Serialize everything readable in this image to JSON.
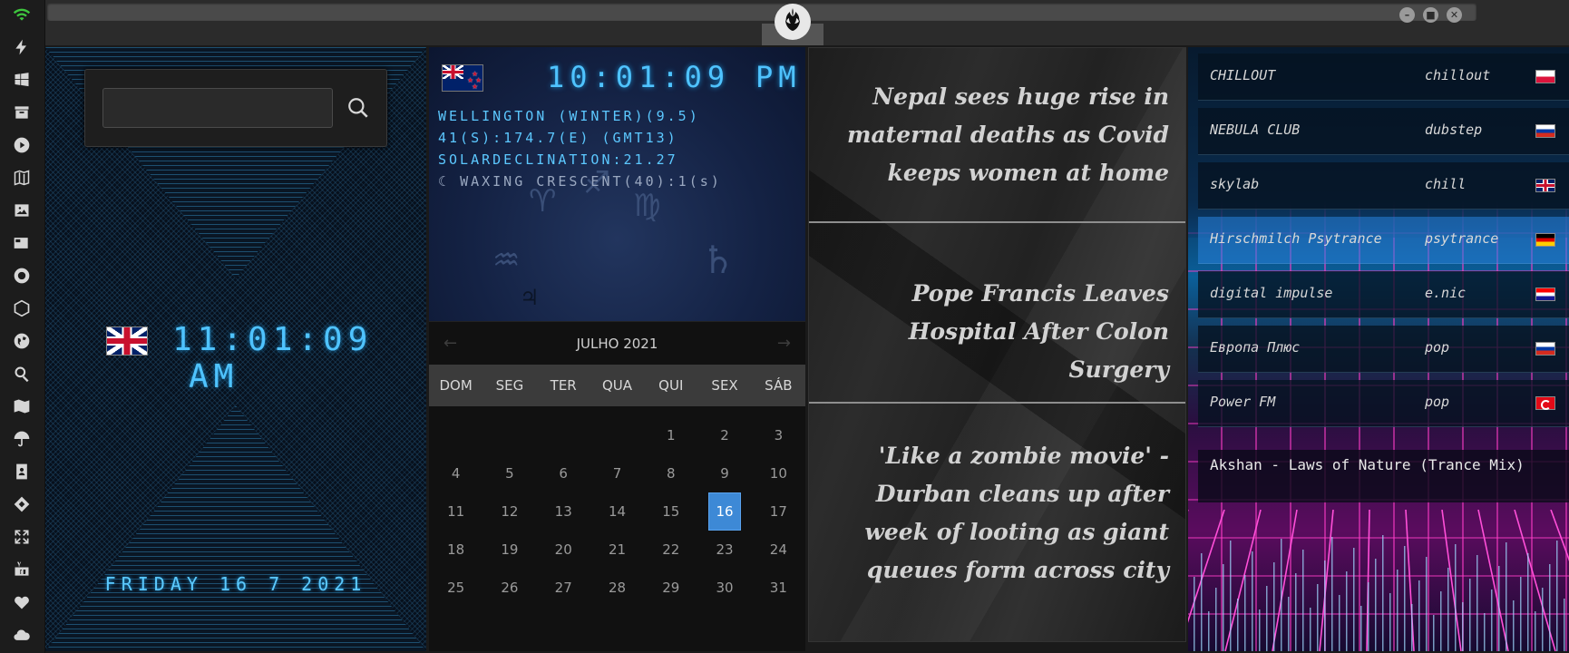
{
  "sidebar": {
    "icons": [
      "wifi-icon",
      "bolt-icon",
      "windows-icon",
      "archive-icon",
      "play-icon",
      "map-book-icon",
      "image-icon",
      "news-icon",
      "empire-icon",
      "rebel-hex-icon",
      "globe-icon",
      "search-icon",
      "map-icon",
      "umbrella-icon",
      "contacts-icon",
      "link-icon",
      "expand-icon",
      "youtube-icon",
      "heart-icon",
      "cloud-icon"
    ]
  },
  "window": {
    "minimize": "–",
    "maximize": "■",
    "close": "✕"
  },
  "search": {
    "value": "",
    "placeholder": ""
  },
  "local_clock": {
    "time": "11:01:09",
    "ampm": "AM",
    "date": "FRIDAY 16 7 2021"
  },
  "world_clock": {
    "time": "10:01:09",
    "ampm": "PM",
    "line1": "WELLINGTON (WINTER)(9.5)",
    "line2": "41(S):174.7(E) (GMT13)",
    "line3": "SOLARDECLINATION:21.27",
    "moon": "WAXING CRESCENT(40):1(s)"
  },
  "calendar": {
    "prev": "←",
    "next": "→",
    "title": "JULHO 2021",
    "weekdays": [
      "DOM",
      "SEG",
      "TER",
      "QUA",
      "QUI",
      "SEX",
      "SÁB"
    ],
    "leading_blanks": 4,
    "days": 31,
    "selected": 16
  },
  "news": [
    {
      "title": "Nepal sees huge rise in maternal deaths as Covid keeps women at home"
    },
    {
      "title": "Pope Francis Leaves Hospital After Colon Surgery"
    },
    {
      "title": "'Like a zombie movie' - Durban cleans up after week of looting as giant queues form across city"
    }
  ],
  "radio": {
    "stations": [
      {
        "name": "CHILLOUT",
        "genre": "chillout",
        "flag": "pl"
      },
      {
        "name": "NEBULA CLUB",
        "genre": "dubstep",
        "flag": "ru"
      },
      {
        "name": "skylab",
        "genre": "chill",
        "flag": "gb"
      },
      {
        "name": "Hirschmilch Psytrance",
        "genre": "psytrance",
        "flag": "de"
      },
      {
        "name": "digital impulse",
        "genre": "e.nic",
        "flag": "hr"
      },
      {
        "name": "Европа Плюс",
        "genre": "pop",
        "flag": "ru"
      },
      {
        "name": "Power FM",
        "genre": "pop",
        "flag": "tr"
      }
    ],
    "selected_index": 3,
    "now_playing": "Akshan - Laws of Nature (Trance Mix)"
  },
  "colors": {
    "clock_cyan": "#4fc3ff",
    "calendar_selected": "#3d89d6",
    "radio_highlight": "#2882dc"
  }
}
